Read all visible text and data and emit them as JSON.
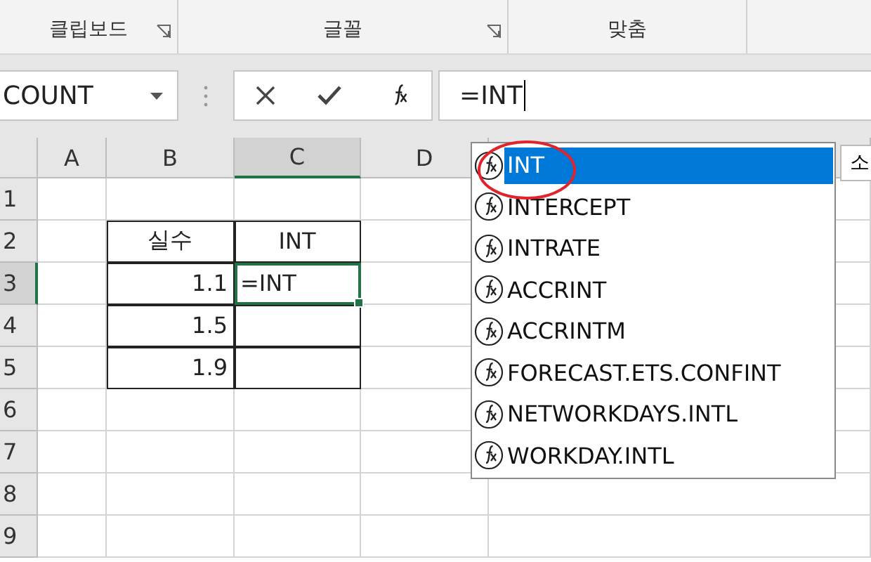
{
  "ribbon": {
    "groups": [
      {
        "label": "클립보드",
        "launcher": true
      },
      {
        "label": "글꼴",
        "launcher": true
      },
      {
        "label": "맞춤",
        "launcher": false
      }
    ]
  },
  "formula_bar": {
    "name_box": "COUNT",
    "formula": "=INT"
  },
  "sheet": {
    "columns": [
      {
        "label": "A",
        "selected": false
      },
      {
        "label": "B",
        "selected": false
      },
      {
        "label": "C",
        "selected": true
      },
      {
        "label": "D",
        "selected": false
      }
    ],
    "rows": [
      {
        "label": "1",
        "selected": false
      },
      {
        "label": "2",
        "selected": false
      },
      {
        "label": "3",
        "selected": true
      },
      {
        "label": "4",
        "selected": false
      },
      {
        "label": "5",
        "selected": false
      },
      {
        "label": "6",
        "selected": false
      },
      {
        "label": "7",
        "selected": false
      },
      {
        "label": "8",
        "selected": false
      },
      {
        "label": "9",
        "selected": false
      }
    ],
    "table": {
      "header": [
        "실수",
        "INT"
      ],
      "rows": [
        {
          "value": "1.1",
          "formula": "=INT",
          "active": true
        },
        {
          "value": "1.5",
          "active": false
        },
        {
          "value": "1.9",
          "active": false
        }
      ]
    }
  },
  "autocomplete": {
    "items": [
      {
        "label": "INT",
        "selected": true
      },
      {
        "label": "INTERCEPT",
        "selected": false
      },
      {
        "label": "INTRATE",
        "selected": false
      },
      {
        "label": "ACCRINT",
        "selected": false
      },
      {
        "label": "ACCRINTM",
        "selected": false
      },
      {
        "label": "FORECAST.ETS.CONFINT",
        "selected": false
      },
      {
        "label": "NETWORKDAYS.INTL",
        "selected": false
      },
      {
        "label": "WORKDAY.INTL",
        "selected": false
      }
    ]
  },
  "tooltip": {
    "text": "소"
  }
}
